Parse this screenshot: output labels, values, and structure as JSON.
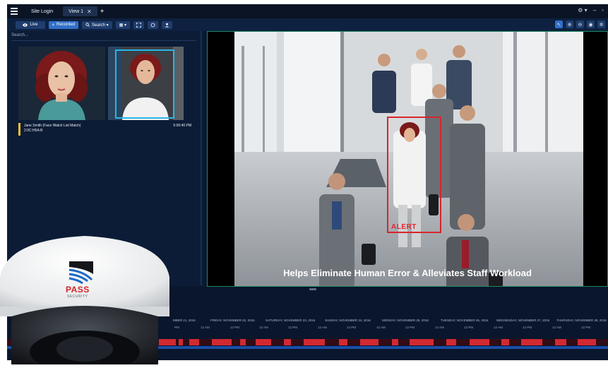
{
  "titlebar": {
    "tabs": [
      {
        "label": "Site Login"
      },
      {
        "label": "View 1",
        "close": "✕"
      }
    ],
    "add_tab": "+",
    "settings_label": "⚙ ▾",
    "minimize": "–",
    "maximize": "▫"
  },
  "toolbar": {
    "live_label": "Live",
    "recorded_label": "Recorded",
    "search_label": "Search ▾",
    "layout_label": "▦ ▾"
  },
  "panel": {
    "search_placeholder": "Search...",
    "alert": {
      "name": "Jane Smith (Face Watch List Match)",
      "id": "2:0C:H5A:B",
      "time": "5:00:40 PM"
    }
  },
  "video": {
    "caption": "Helps Eliminate Human Error & Alleviates Staff Workload",
    "alert_label": "ALERT"
  },
  "timeline": {
    "dates": [
      "MBER 21, 2016",
      "FRIDAY, NOVEMBER 22, 2016",
      "SATURDAY, NOVEMBER 23, 2016",
      "SUNDAY, NOVEMBER 24, 2016",
      "MONDAY, NOVEMBER 25, 2016",
      "TUESDAY, NOVEMBER 26, 2016",
      "WEDNESDAY, NOVEMBER 27, 2016",
      "THURSDAY, NOVEMBER 28, 2016"
    ],
    "times": [
      "PM",
      "12 AM",
      "12 PM",
      "12 AM",
      "12 PM",
      "12 AM",
      "12 PM",
      "12 AM",
      "12 PM",
      "12 AM",
      "12 PM",
      "12 AM",
      "12 PM",
      "12 AM",
      "12 PM"
    ]
  },
  "branding": {
    "logo_text": "PASS",
    "logo_subtext": "SECURITY"
  },
  "colors": {
    "accent": "#3170c8",
    "alert": "#d8252c",
    "detection": "#27b7e6"
  }
}
